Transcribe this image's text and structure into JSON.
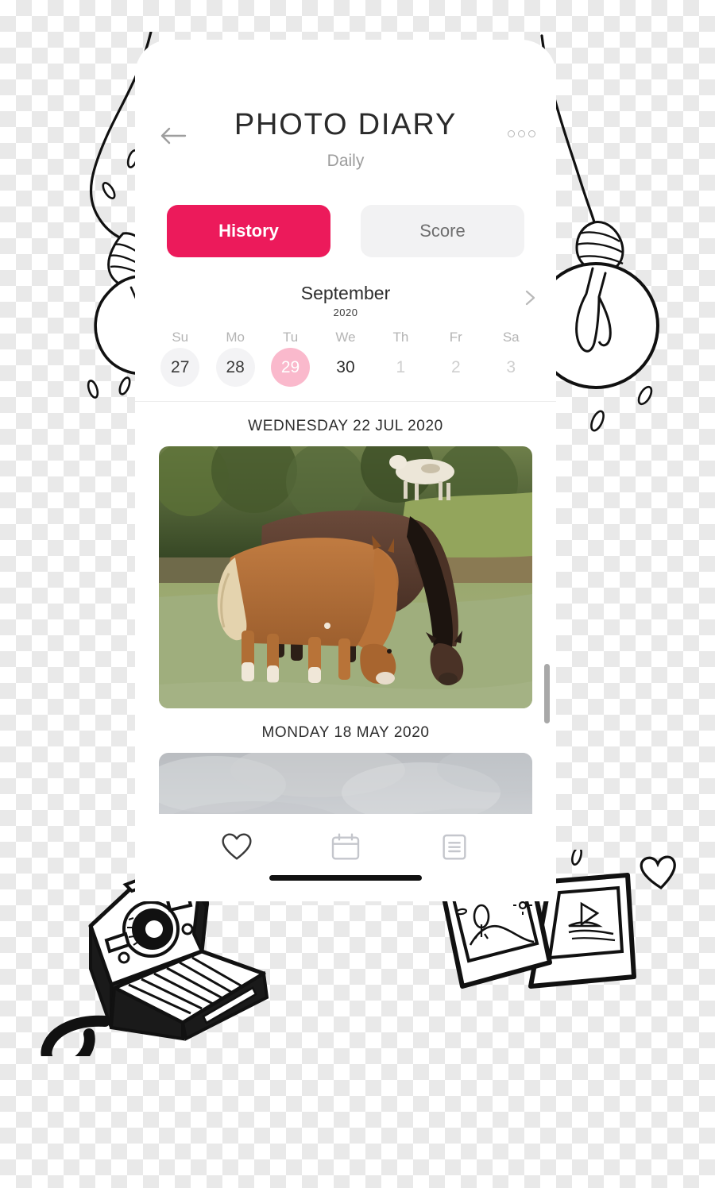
{
  "app": {
    "title": "PHOTO DIARY",
    "subtitle": "Daily"
  },
  "header": {
    "back_icon": "back-arrow-icon",
    "more_icon": "more-options-icon"
  },
  "tabs": [
    {
      "label": "History",
      "active": true
    },
    {
      "label": "Score",
      "active": false
    }
  ],
  "calendar": {
    "month": "September",
    "year": "2020",
    "next_icon": "chevron-right-icon",
    "day_names": [
      "Su",
      "Mo",
      "Tu",
      "We",
      "Th",
      "Fr",
      "Sa"
    ],
    "days": [
      {
        "label": "27",
        "state": "past"
      },
      {
        "label": "28",
        "state": "past"
      },
      {
        "label": "29",
        "state": "today"
      },
      {
        "label": "30",
        "state": "plain"
      },
      {
        "label": "1",
        "state": "future"
      },
      {
        "label": "2",
        "state": "future"
      },
      {
        "label": "3",
        "state": "future"
      }
    ]
  },
  "feed": {
    "entries": [
      {
        "date": "WEDNESDAY 22 JUL 2020",
        "photo": "two-horses-grazing-in-field"
      },
      {
        "date": "MONDAY 18 MAY 2020",
        "photo": "overcast-gray-sky"
      }
    ]
  },
  "bottom_nav": [
    {
      "icon": "heart-icon",
      "active": true
    },
    {
      "icon": "calendar-icon",
      "active": false
    },
    {
      "icon": "document-icon",
      "active": false
    }
  ],
  "doodles": [
    {
      "name": "hanging-lightbulb-left"
    },
    {
      "name": "hanging-lightbulb-right"
    },
    {
      "name": "polaroid-camera"
    },
    {
      "name": "photo-frames"
    }
  ],
  "colors": {
    "accent_pink": "#ec1a5b",
    "selected_day_pink": "#fab9cc",
    "inactive_tab_gray": "#f2f2f3",
    "muted_text": "#b4b4b4"
  }
}
